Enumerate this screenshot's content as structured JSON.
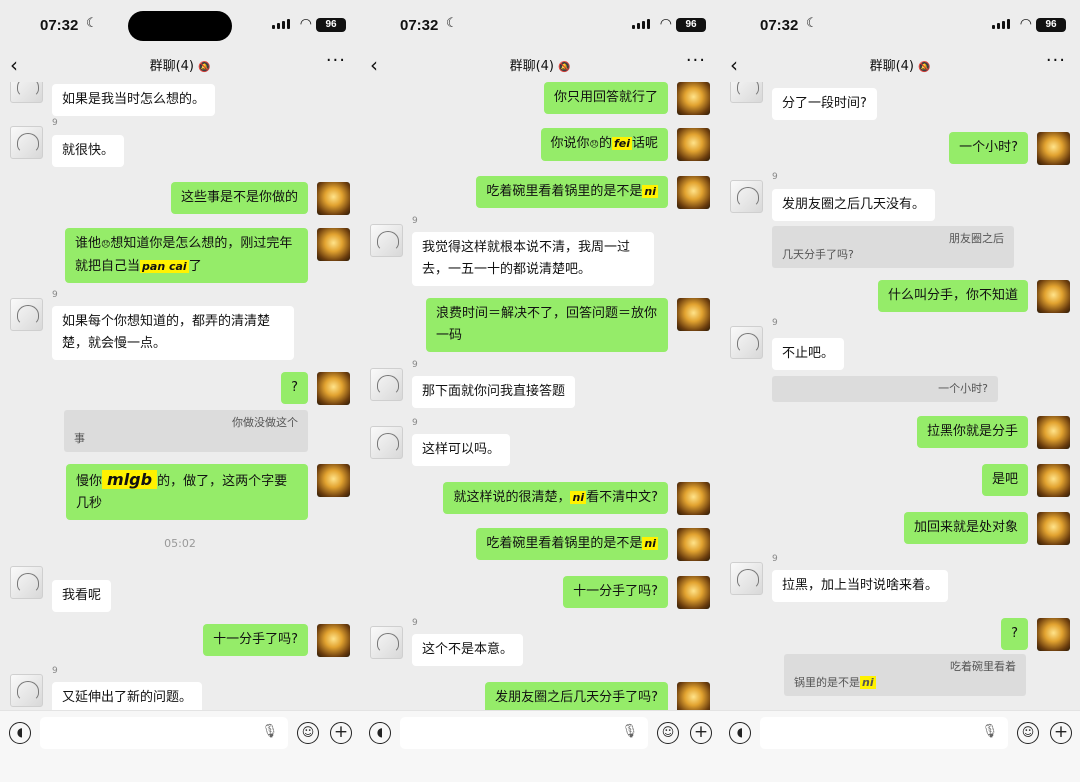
{
  "status": {
    "time": "07:32",
    "battery": "96"
  },
  "header": {
    "back_icon": "chevron-left",
    "title": "群聊(4)",
    "more_icon": "more-dots"
  },
  "phone1": {
    "m1": "如果是我当时怎么想的。",
    "nick": "9",
    "m2": "就很快。",
    "m3": "这些事是不是你做的",
    "m4a": "谁他",
    "m4b": "想知道你是怎么想的，刚过完年就把自己当",
    "m4hl": "pan cai",
    "m4c": "了",
    "m5": "如果每个你想知道的，都弄的清清楚楚，就会慢一点。",
    "m6": "?",
    "q1a": "你做没做这个",
    "q1b": "事",
    "m7a": "慢你",
    "m7hl": "mlgb",
    "m7b": "的，做了，这两个字要几秒",
    "ts": "05:02",
    "m8": "我看呢",
    "m9": "十一分手了吗?",
    "m10": "又延伸出了新的问题。"
  },
  "phone2": {
    "m1": "你只用回答就行了",
    "m2a": "你说你",
    "m2b": "的",
    "m2hl": "fei",
    "m2c": "话呢",
    "m3a": "吃着碗里看着锅里的是不是",
    "m3hl": "ni",
    "nick": "9",
    "m4": "我觉得这样就根本说不清，我周一过去，一五一十的都说清楚吧。",
    "m5": "浪费时间＝解决不了，回答问题＝放你一码",
    "m6": "那下面就你问我直接答题",
    "m7": "这样可以吗。",
    "m8a": "就这样说的很清楚，",
    "m8hl": "ni",
    "m8b": "看不清中文?",
    "m9a": "吃着碗里看着锅里的是不是",
    "m9hl": "ni",
    "m10": "十一分手了吗?",
    "m11": "这个不是本意。",
    "m12": "发朋友圈之后几天分手了吗?"
  },
  "phone3": {
    "m1": "分了一段时间?",
    "m2": "一个小时?",
    "nick": "9",
    "m3": "发朋友圈之后几天没有。",
    "q1a": "朋友圈之后",
    "q1b": "几天分手了吗?",
    "m4": "什么叫分手，你不知道",
    "m5": "不止吧。",
    "q2": "一个小时?",
    "m6": "拉黑你就是分手",
    "m7": "是吧",
    "m8": "加回来就是处对象",
    "m9": "拉黑，加上当时说啥来着。",
    "m10": "?",
    "q3a": "吃着碗里看着",
    "q3b": "锅里的是不是",
    "q3hl": "ni"
  },
  "input": {
    "voice_icon": "voice",
    "mic_icon": "mic",
    "emoji_icon": "emoji",
    "plus_icon": "plus"
  },
  "colors": {
    "bg": "#ededed",
    "sent": "#95ec69",
    "received": "#ffffff",
    "highlight": "#fff200"
  }
}
